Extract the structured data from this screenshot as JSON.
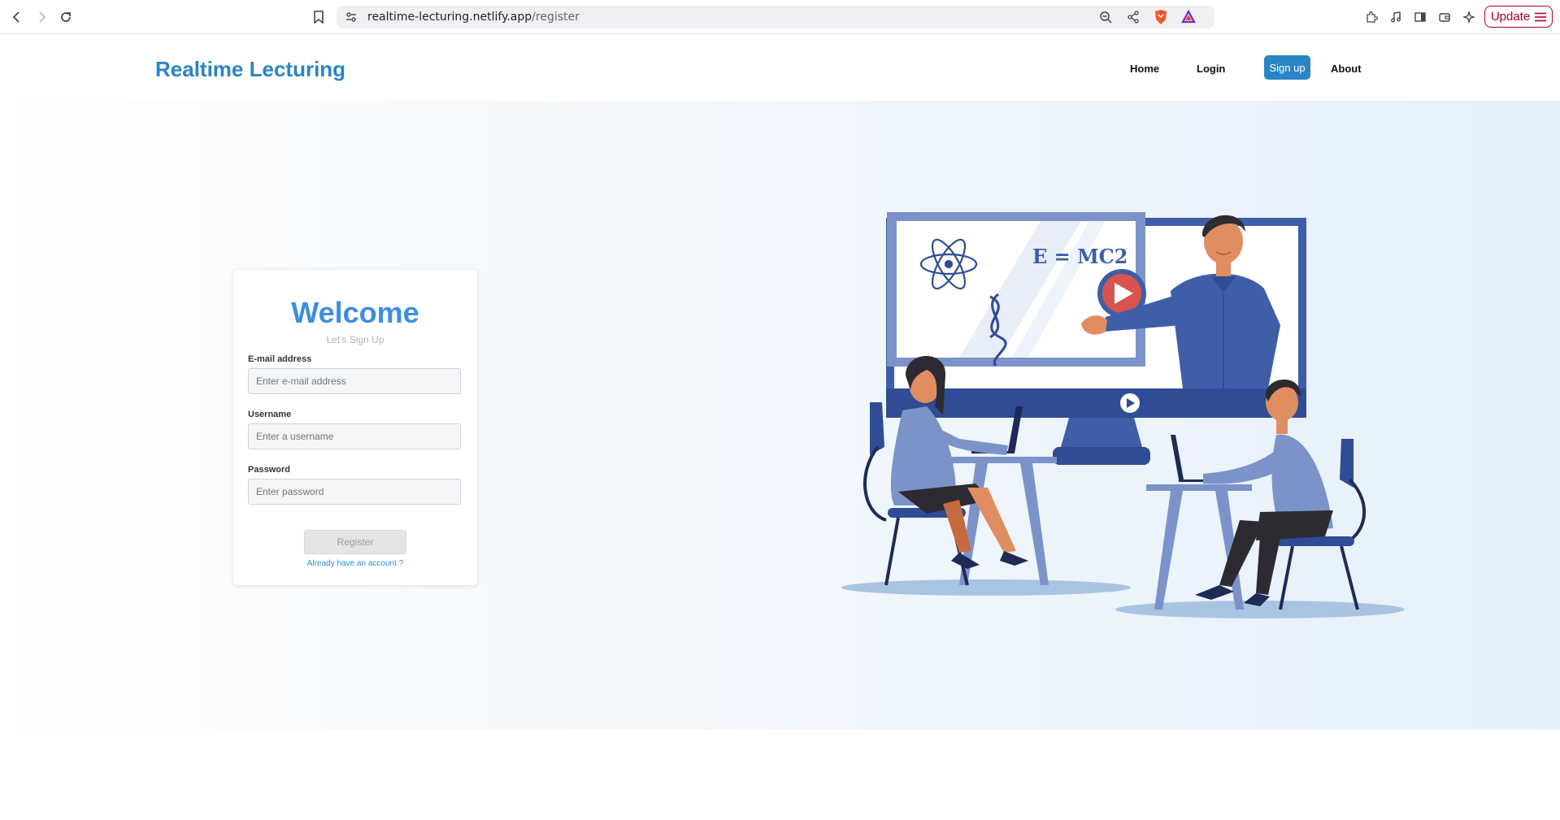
{
  "browser": {
    "url_host": "realtime-lecturing.netlify.app",
    "url_path": "/register",
    "update_label": "Update"
  },
  "header": {
    "brand": "Realtime Lecturing",
    "nav": {
      "home": "Home",
      "login": "Login",
      "signup": "Sign up",
      "about": "About"
    }
  },
  "form": {
    "title": "Welcome",
    "subtitle": "Let's Sign Up",
    "email": {
      "label": "E-mail address",
      "placeholder": "Enter e-mail address",
      "value": ""
    },
    "username": {
      "label": "Username",
      "placeholder": "Enter a username",
      "value": ""
    },
    "password": {
      "label": "Password",
      "placeholder": "Enter password",
      "value": ""
    },
    "submit_label": "Register",
    "login_link": "Already have an account ?"
  },
  "illustration": {
    "board_text": "E = MC2"
  },
  "colors": {
    "brand": "#2a85c5",
    "welcome": "#3d8de0",
    "illustration_primary": "#3f5ea8",
    "illustration_light": "#7b93c9",
    "play_red": "#d9534f"
  }
}
